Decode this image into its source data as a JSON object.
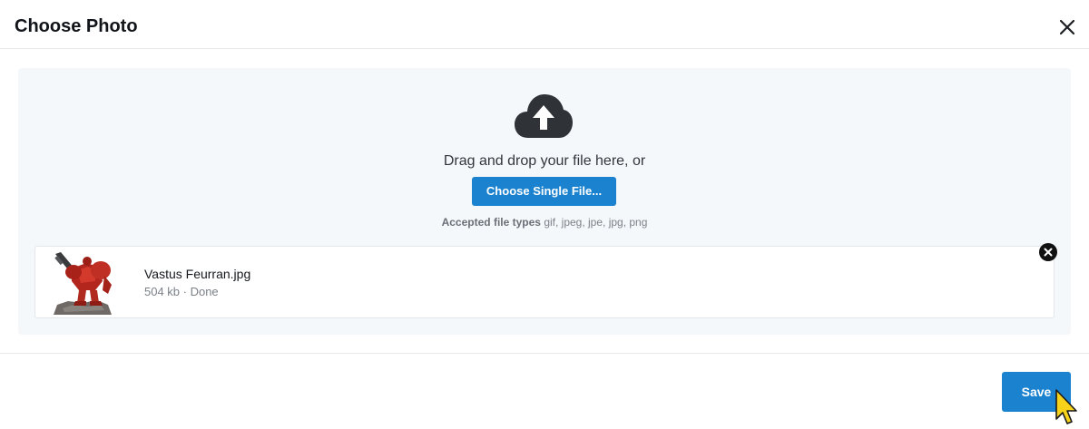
{
  "dialog": {
    "title": "Choose Photo",
    "close_icon": "close-icon"
  },
  "upload": {
    "icon": "cloud-upload-icon",
    "drop_text": "Drag and drop your file here, or",
    "choose_button": "Choose Single File...",
    "accepted_label": "Accepted file types",
    "accepted_types": "gif, jpeg, jpe, jpg, png"
  },
  "file": {
    "name": "Vastus Feurran.jpg",
    "meta": "504 kb · Done",
    "remove_icon": "remove-file-icon",
    "thumbnail_icon": "image-thumbnail"
  },
  "footer": {
    "save_button": "Save"
  },
  "colors": {
    "accent": "#1a82cf",
    "panel_bg": "#f5f8fa",
    "icon_dark": "#2f3338"
  }
}
